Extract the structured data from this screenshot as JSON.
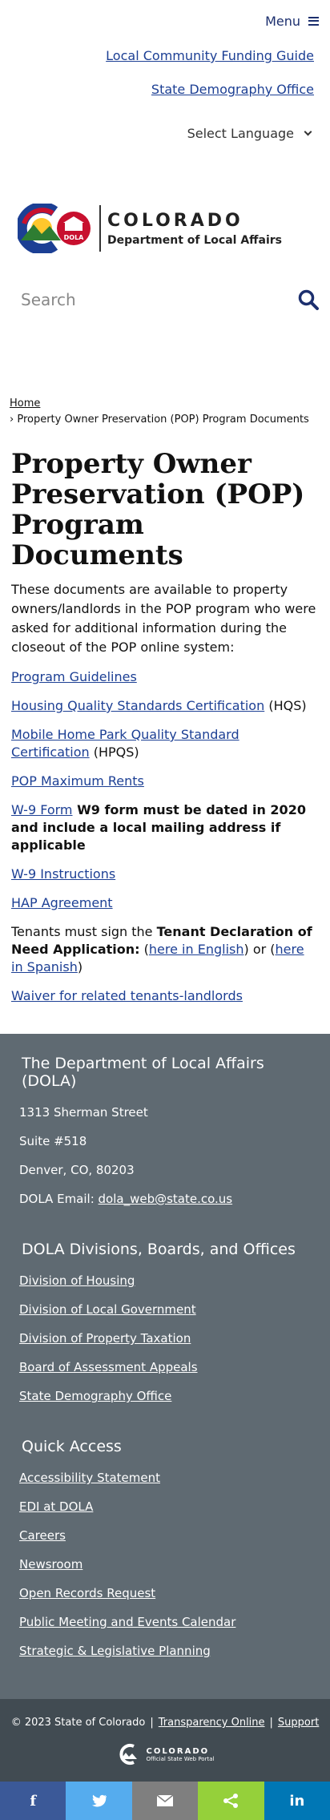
{
  "header": {
    "menu_label": "Menu",
    "links": [
      "Local Community Funding Guide",
      "State Demography Office"
    ],
    "language_label": "Select Language",
    "logo_line1": "COLORADO",
    "logo_line2": "Department of Local Affairs",
    "dola_badge": "DOLA",
    "search_placeholder": "Search"
  },
  "breadcrumb": {
    "home": "Home",
    "current": "› Property Owner Preservation (POP) Program Documents"
  },
  "page": {
    "title": "Property Owner Preservation (POP) Program Documents",
    "intro": "These documents are available to property owners/landlords in the POP program who were asked for additional information during the closeout of the POP online system:",
    "items": {
      "guidelines": "Program Guidelines",
      "hqs_link": "Housing Quality Standards Certification",
      "hqs_suffix": " (HQS)",
      "hpqs_link": "Mobile Home Park Quality Standard Certification",
      "hpqs_suffix": " (HPQS)",
      "max_rents": "POP Maximum Rents",
      "w9_link": "W-9 Form",
      "w9_note": " W9 form must be dated in 2020 and include a local mailing address if applicable",
      "w9_instructions": "W-9 Instructions",
      "hap": "HAP Agreement",
      "tenants_prefix": "Tenants must sign the ",
      "tenants_bold": "Tenant Declaration of Need Application:",
      "tenants_open1": " (",
      "tenants_english": "here in English",
      "tenants_mid": ") or (",
      "tenants_spanish": "here in Spanish",
      "tenants_close": ")",
      "waiver": "Waiver for related tenants-landlords"
    }
  },
  "footer": {
    "org_heading": "The Department of Local Affairs (DOLA)",
    "address1": "1313 Sherman Street",
    "address2": "Suite  #518",
    "address3": "Denver, CO, 80203",
    "email_label": "DOLA Email: ",
    "email": "dola_web@state.co.us",
    "divisions_heading": "DOLA Divisions, Boards, and Offices",
    "divisions": [
      "Division of Housing",
      "Division of Local Government",
      "Division of Property Taxation",
      "Board of Assessment Appeals",
      "State Demography Office"
    ],
    "quick_heading": "Quick Access",
    "quick": [
      "Accessibility Statement",
      "EDI at DOLA",
      "Careers",
      "Newsroom",
      "Open Records Request",
      "Public Meeting and Events Calendar",
      "Strategic & Legislative Planning"
    ],
    "copyright": "© 2023 State of Colorado",
    "transparency": "Transparency Online",
    "support": "Support",
    "portal_line1": "COLORADO",
    "portal_line2": "Official State Web Portal"
  },
  "share": {
    "buttons": [
      {
        "icon": "facebook-icon",
        "glyph": "f",
        "color": "#3b5998"
      },
      {
        "icon": "twitter-icon",
        "glyph": "🐦",
        "color": "#55acee"
      },
      {
        "icon": "email-icon",
        "glyph": "✉",
        "color": "#7f7f7f"
      },
      {
        "icon": "share-icon",
        "glyph": "<",
        "color": "#95d03a"
      },
      {
        "icon": "linkedin-icon",
        "glyph": "in",
        "color": "#0077b5"
      }
    ]
  },
  "colors": {
    "link": "#1c3f94",
    "footer_bg": "#5f6a72",
    "bottom_bg": "#414b52"
  }
}
